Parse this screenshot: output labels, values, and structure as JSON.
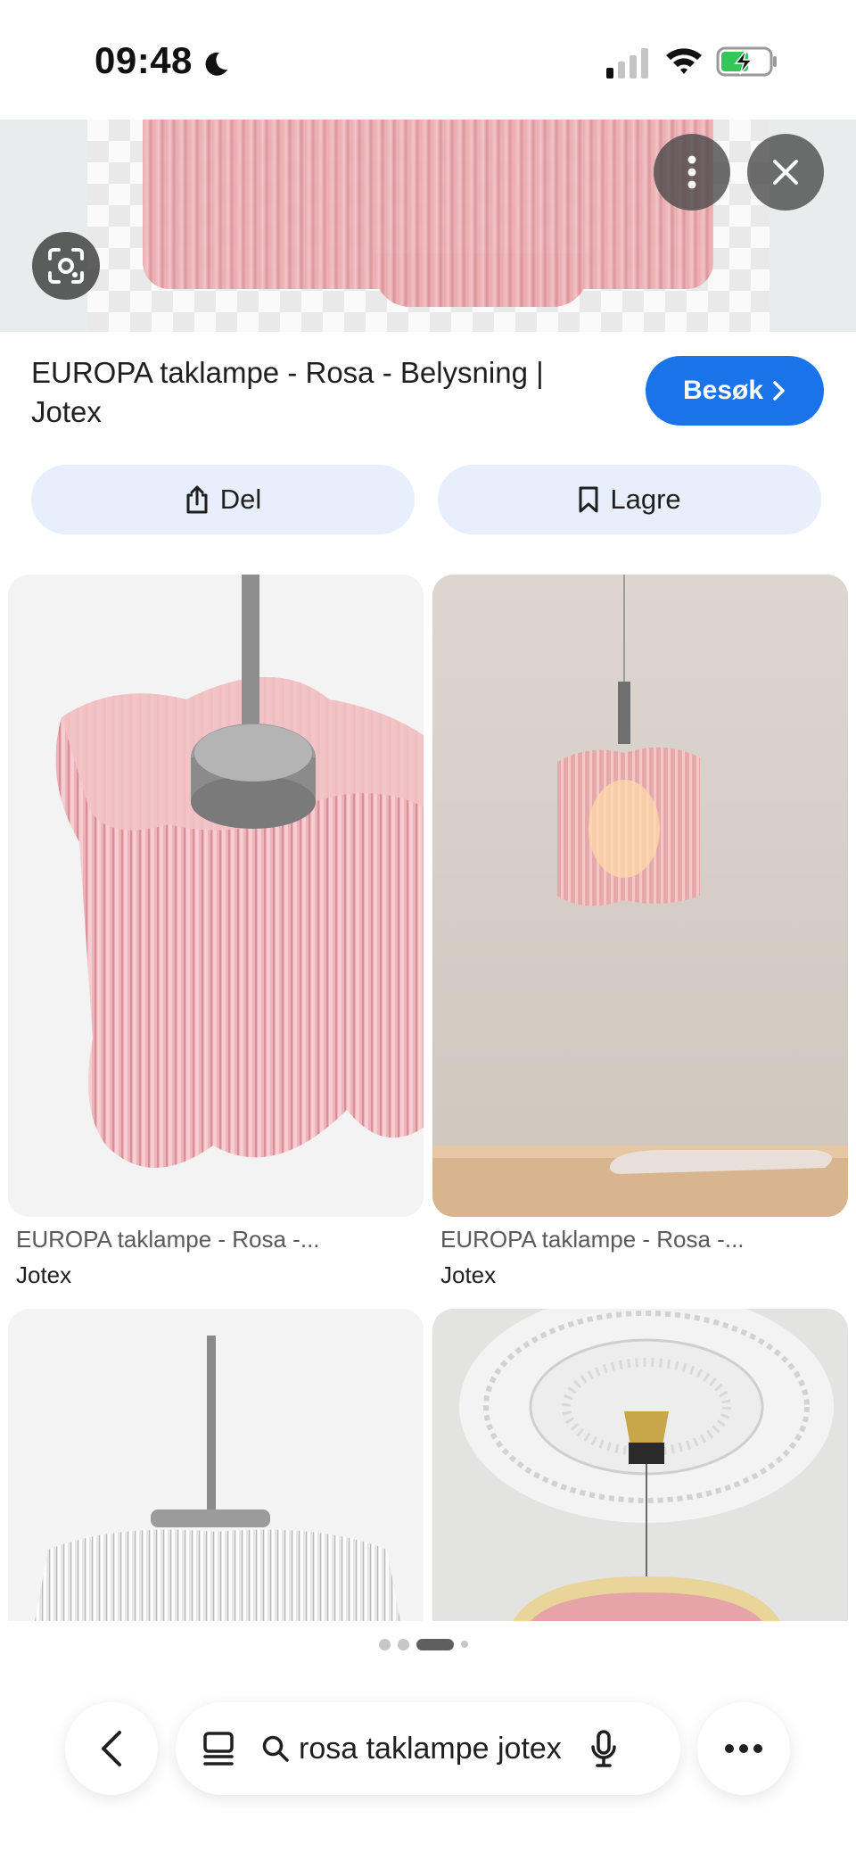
{
  "status_bar": {
    "time": "09:48",
    "icons": [
      "moon-icon",
      "signal-icon",
      "wifi-icon",
      "battery-charging-icon"
    ]
  },
  "hero": {
    "image": "pink-ribbed-glass-lamp-image",
    "buttons": [
      "more-vert-icon",
      "close-icon",
      "lens-icon"
    ]
  },
  "result": {
    "title": "EUROPA taklampe - Rosa - Belysning | Jotex",
    "visit_label": "Besøk",
    "share_label": "Del",
    "save_label": "Lagre"
  },
  "related": [
    {
      "caption": "EUROPA taklampe - Rosa -...",
      "source": "Jotex",
      "image": "pink-lamp-closeup"
    },
    {
      "caption": "EUROPA taklampe - Rosa -...",
      "source": "Jotex",
      "image": "pink-lamp-hanging"
    },
    {
      "caption": "",
      "source": "",
      "image": "clear-glass-lamp"
    },
    {
      "caption": "",
      "source": "",
      "image": "ceiling-rosette-pink-lamp"
    }
  ],
  "pager": {
    "count": 4,
    "active_index": 2
  },
  "search": {
    "query": "rosa taklampe jotex"
  },
  "colors": {
    "accent": "#1a73e8",
    "pill": "#e8effc",
    "lamp_pink": "#e9a7ad"
  }
}
